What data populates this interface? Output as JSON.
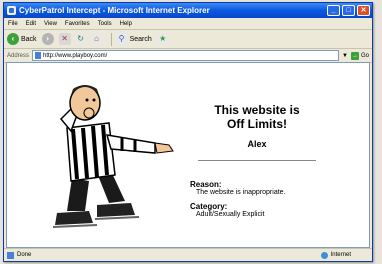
{
  "window": {
    "title": "CyberPatrol Intercept - Microsoft Internet Explorer"
  },
  "menu": [
    "File",
    "Edit",
    "View",
    "Favorites",
    "Tools",
    "Help"
  ],
  "toolbar": {
    "back_label": "Back",
    "search_label": "Search"
  },
  "address": {
    "label": "Address",
    "url": "http://www.playboy.com/",
    "go_label": "Go"
  },
  "page": {
    "title_line1": "This website is",
    "title_line2": "Off Limits!",
    "user": "Alex",
    "reason_label": "Reason:",
    "reason_value": "The website is inappropriate.",
    "category_label": "Category:",
    "category_value": "Adult/Sexually Explicit"
  },
  "status": {
    "left": "Done",
    "zone": "Internet"
  },
  "colors": {
    "titlebar": "#0a58e0",
    "chrome": "#ece9d8"
  }
}
